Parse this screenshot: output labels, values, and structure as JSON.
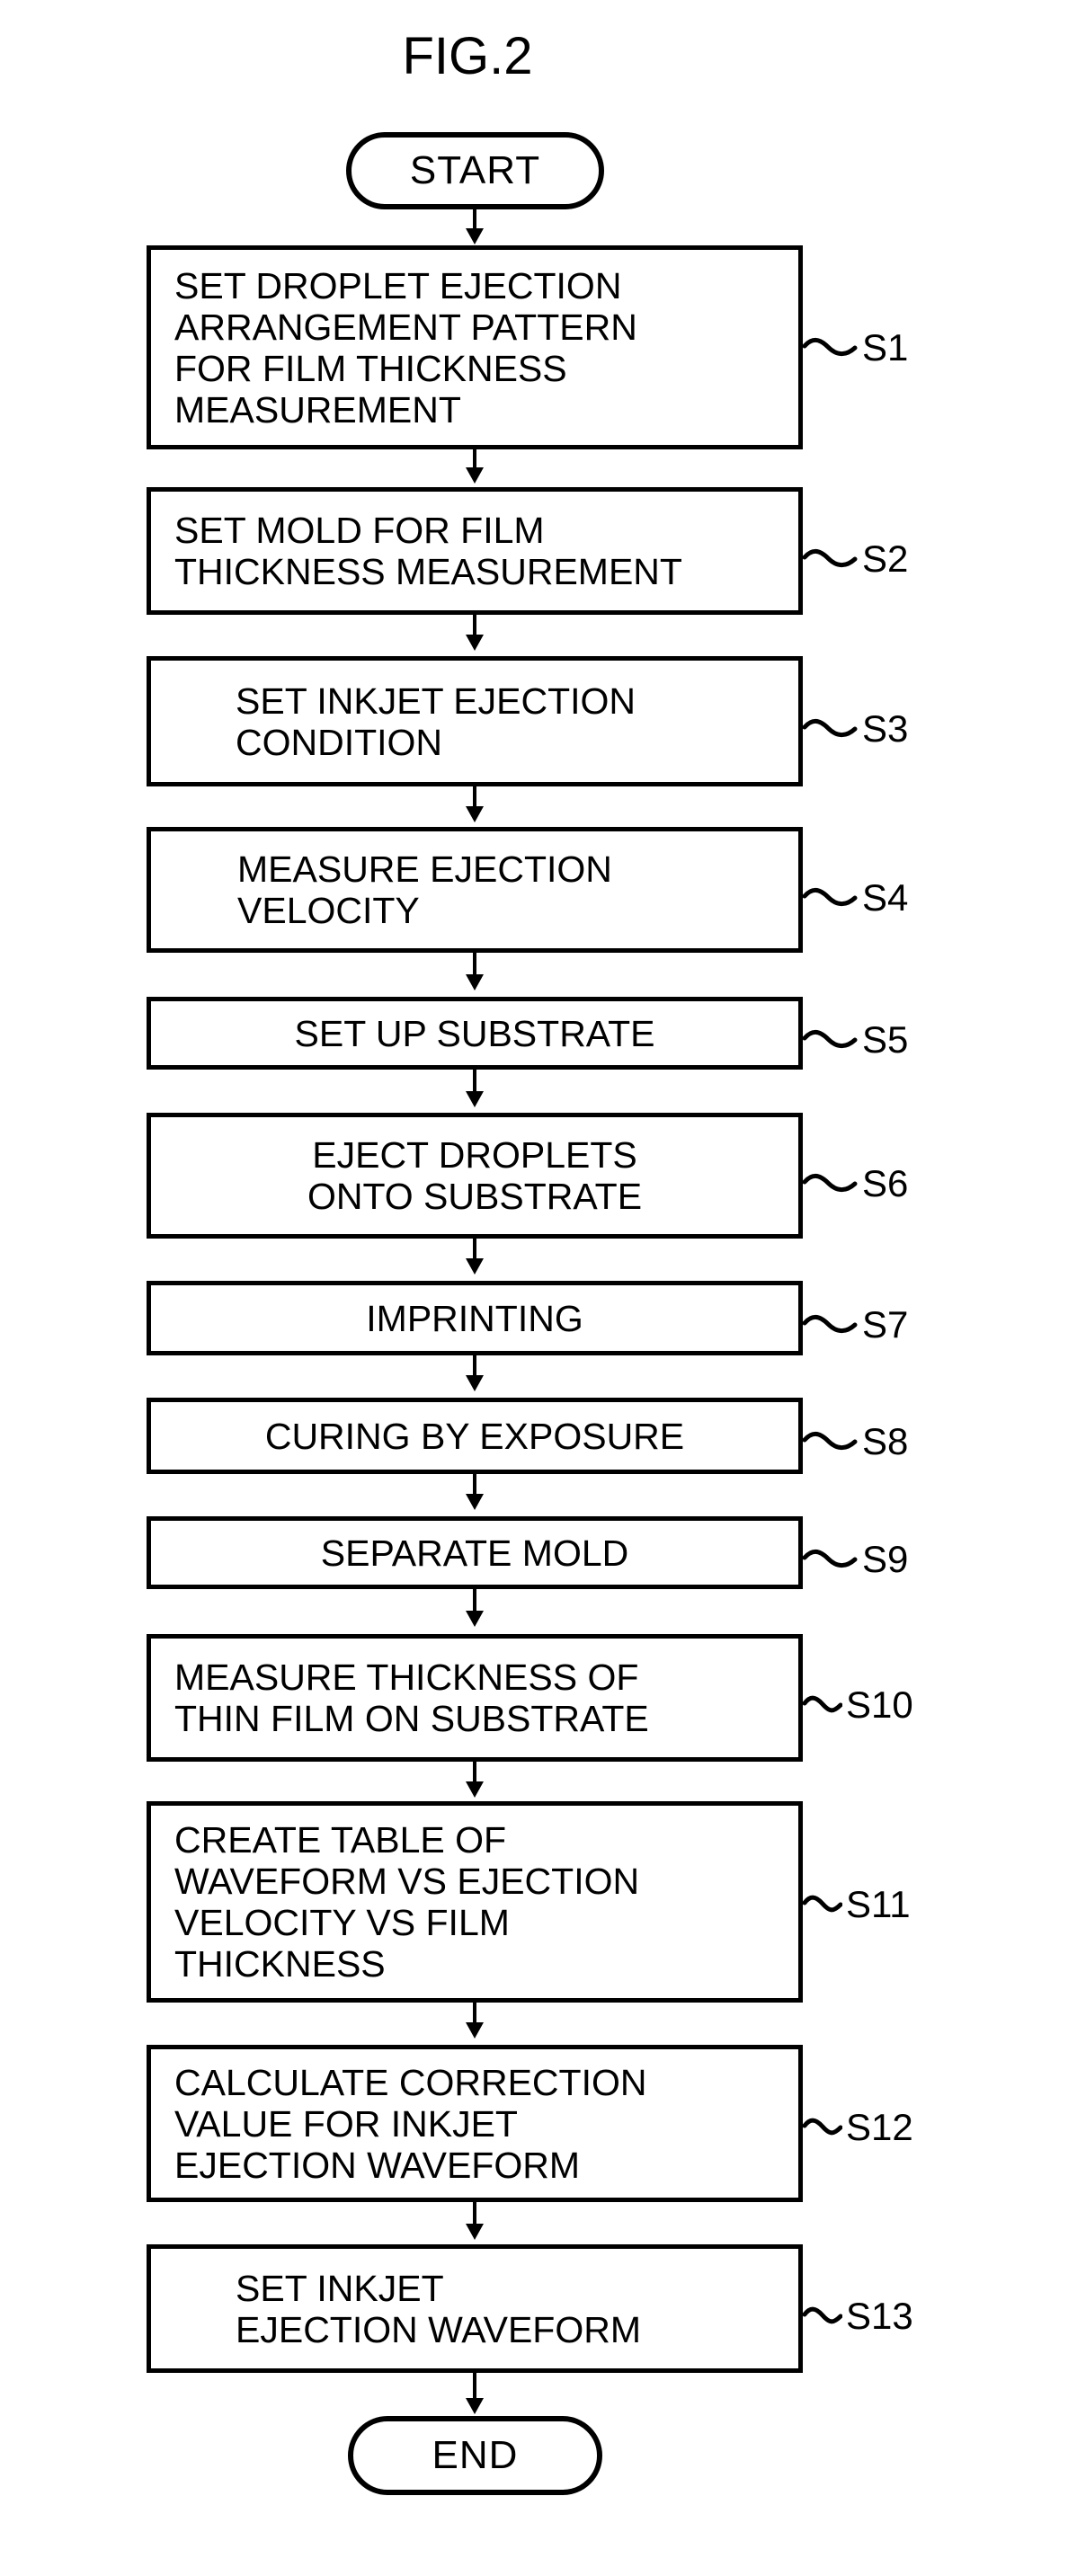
{
  "figure": {
    "title": "FIG.2"
  },
  "terminators": {
    "start": "START",
    "end": "END"
  },
  "flow": {
    "steps": [
      {
        "ref": "S1",
        "tilde": "~",
        "lines": [
          "SET DROPLET EJECTION",
          "ARRANGEMENT PATTERN",
          "FOR FILM THICKNESS",
          "MEASUREMENT"
        ]
      },
      {
        "ref": "S2",
        "tilde": "~",
        "lines": [
          "SET MOLD FOR FILM",
          "THICKNESS MEASUREMENT"
        ]
      },
      {
        "ref": "S3",
        "tilde": "~",
        "lines": [
          "SET INKJET EJECTION",
          "CONDITION"
        ]
      },
      {
        "ref": "S4",
        "tilde": "~",
        "lines": [
          "MEASURE EJECTION",
          "VELOCITY"
        ]
      },
      {
        "ref": "S5",
        "tilde": "~",
        "lines": [
          "SET UP SUBSTRATE"
        ]
      },
      {
        "ref": "S6",
        "tilde": "~",
        "lines": [
          "EJECT DROPLETS",
          "ONTO SUBSTRATE"
        ]
      },
      {
        "ref": "S7",
        "tilde": "~",
        "lines": [
          "IMPRINTING"
        ]
      },
      {
        "ref": "S8",
        "tilde": "~",
        "lines": [
          "CURING BY EXPOSURE"
        ]
      },
      {
        "ref": "S9",
        "tilde": "~",
        "lines": [
          "SEPARATE MOLD"
        ]
      },
      {
        "ref": "S10",
        "tilde": "~",
        "lines": [
          "MEASURE THICKNESS OF",
          "THIN FILM ON SUBSTRATE"
        ]
      },
      {
        "ref": "S11",
        "tilde": "~",
        "lines": [
          "CREATE TABLE OF",
          "WAVEFORM VS EJECTION",
          "VELOCITY VS FILM",
          "THICKNESS"
        ]
      },
      {
        "ref": "S12",
        "tilde": "~",
        "lines": [
          "CALCULATE CORRECTION",
          "VALUE FOR INKJET",
          "EJECTION WAVEFORM"
        ]
      },
      {
        "ref": "S13",
        "tilde": "~",
        "lines": [
          "SET INKJET",
          "EJECTION WAVEFORM"
        ]
      }
    ]
  },
  "colors": {
    "stroke": "#000000",
    "background": "#ffffff"
  }
}
